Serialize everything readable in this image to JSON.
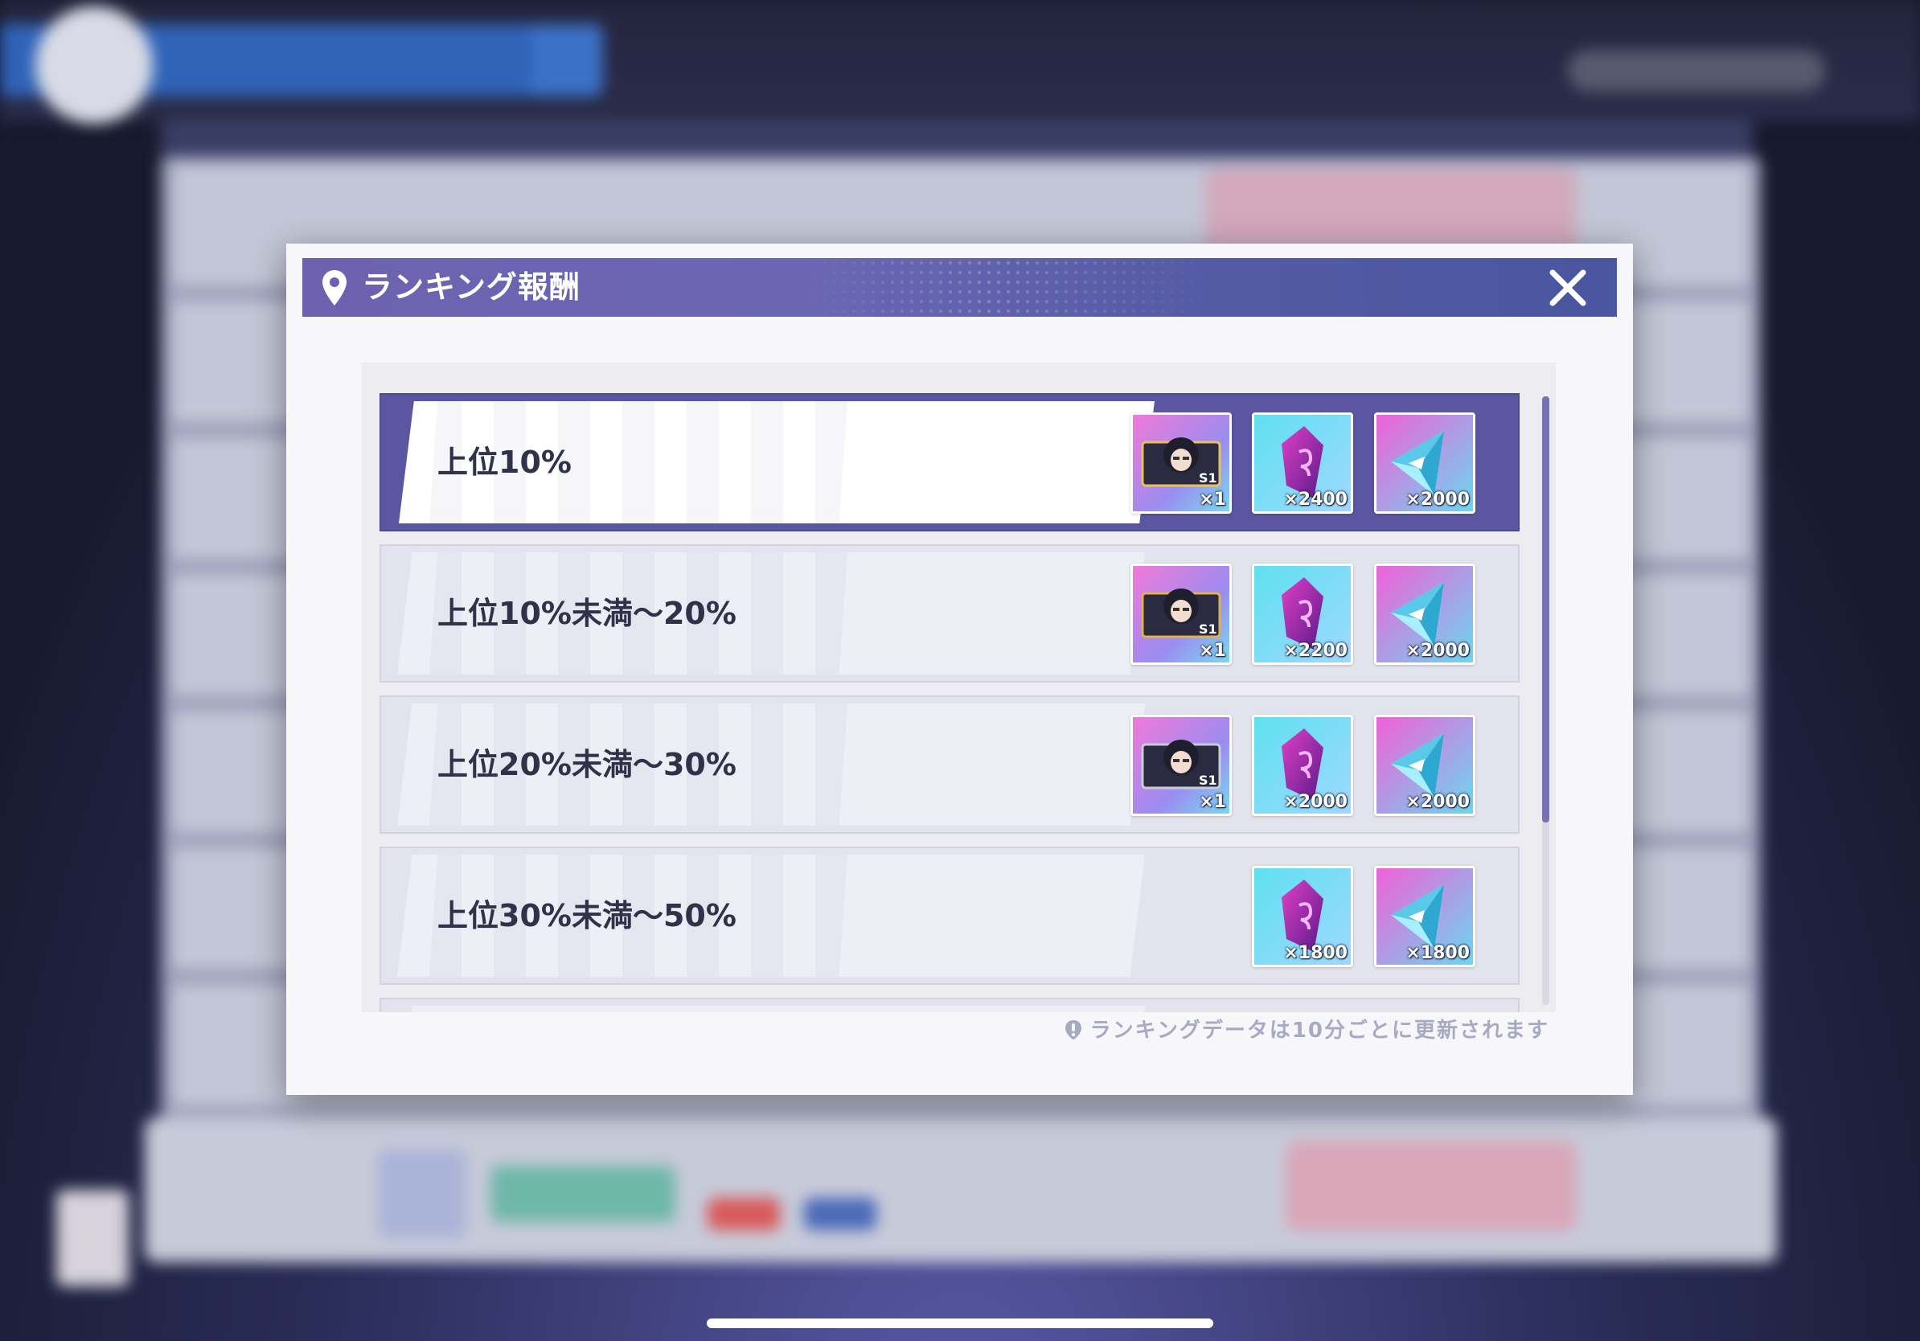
{
  "modal": {
    "title": "ランキング報酬",
    "note": "ランキングデータは10分ごとに更新されます"
  },
  "rows": [
    {
      "label": "上位10%",
      "highlighted": true,
      "rewards": [
        {
          "icon": "character-card-s1",
          "qty": "×1"
        },
        {
          "icon": "purple-crystal",
          "qty": "×2400"
        },
        {
          "icon": "cyan-prism",
          "qty": "×2000"
        }
      ]
    },
    {
      "label": "上位10%未満～20%",
      "highlighted": false,
      "rewards": [
        {
          "icon": "character-card-s1",
          "qty": "×1"
        },
        {
          "icon": "purple-crystal",
          "qty": "×2200"
        },
        {
          "icon": "cyan-prism",
          "qty": "×2000"
        }
      ]
    },
    {
      "label": "上位20%未満～30%",
      "highlighted": false,
      "rewards": [
        {
          "icon": "character-card-s1",
          "qty": "×1"
        },
        {
          "icon": "purple-crystal",
          "qty": "×2000"
        },
        {
          "icon": "cyan-prism",
          "qty": "×2000"
        }
      ]
    },
    {
      "label": "上位30%未満～50%",
      "highlighted": false,
      "rewards": [
        {
          "icon": "purple-crystal",
          "qty": "×1800"
        },
        {
          "icon": "cyan-prism",
          "qty": "×1800"
        }
      ]
    }
  ],
  "colors": {
    "header": "#5c5ca8",
    "highlight_row": "#5a56a2",
    "row": "#e3e3ee"
  }
}
